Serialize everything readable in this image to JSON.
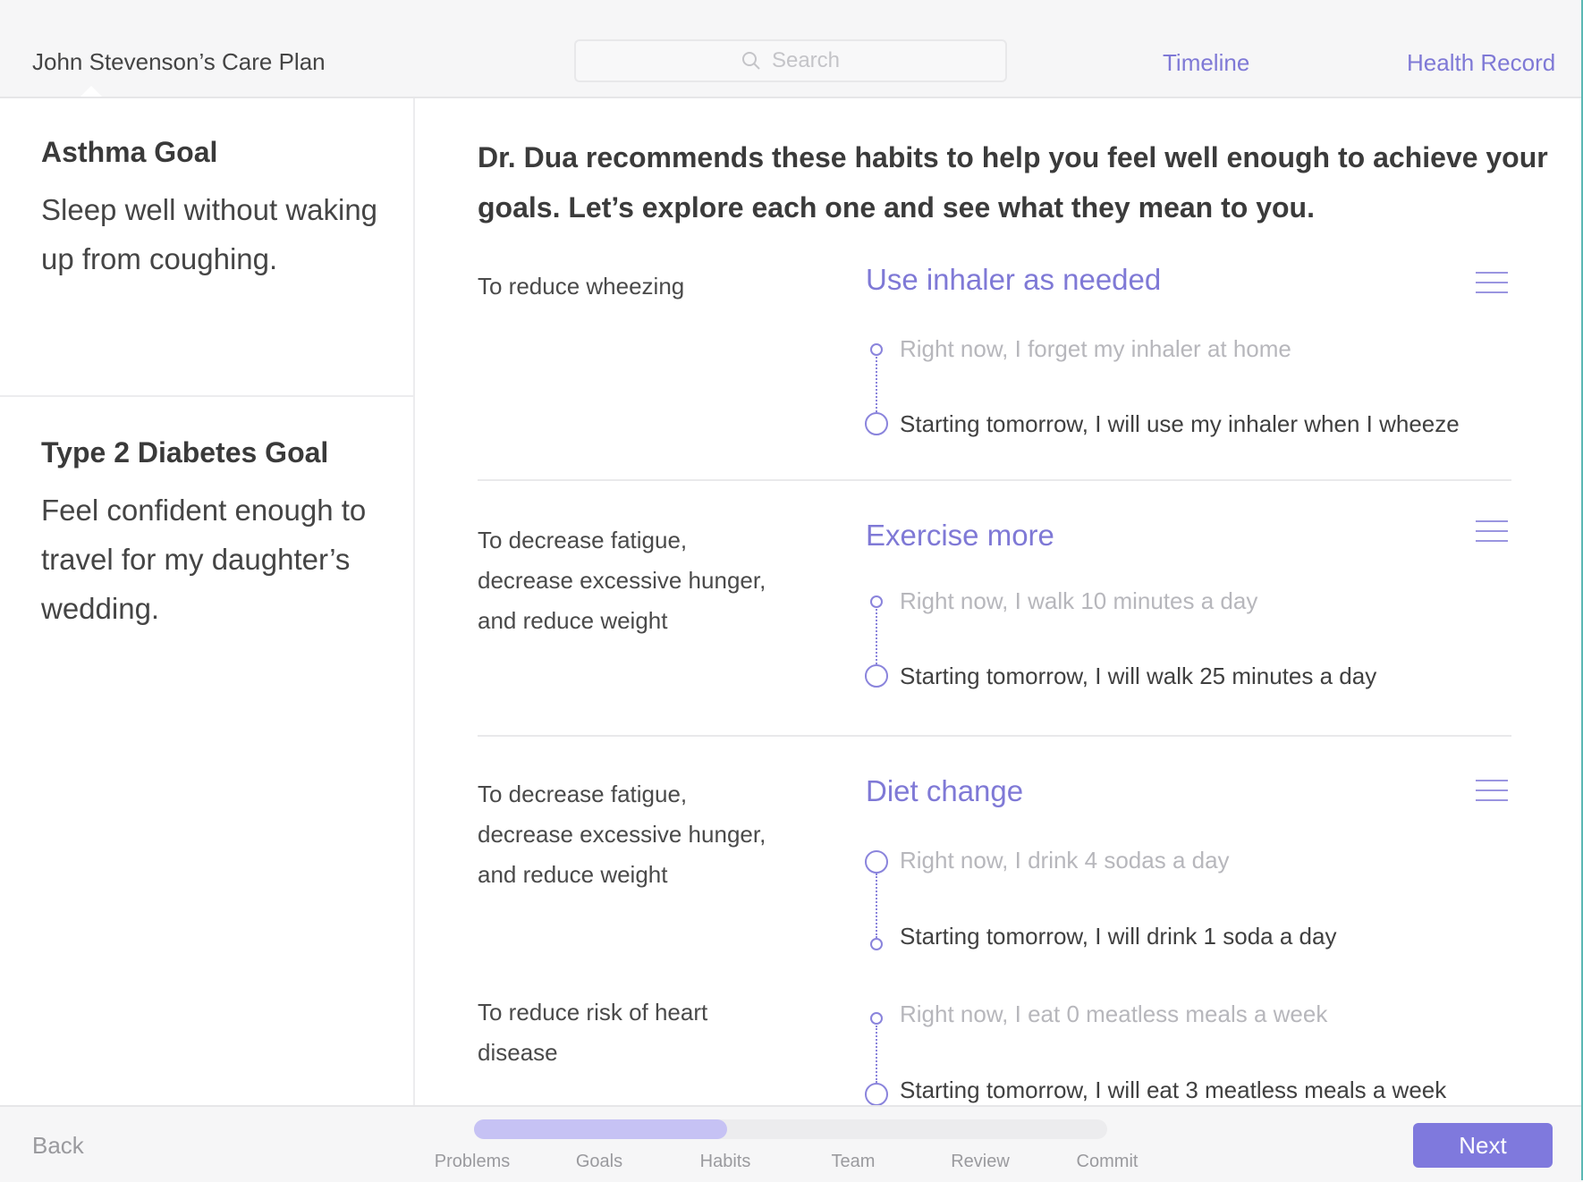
{
  "header": {
    "plan_title": "John Stevenson’s Care Plan",
    "search_placeholder": "Search",
    "nav": [
      "Timeline",
      "Health Record"
    ]
  },
  "sidebar": {
    "goals": [
      {
        "title": "Asthma Goal",
        "description": "Sleep well without waking up from coughing."
      },
      {
        "title": "Type 2 Diabetes Goal",
        "description": "Feel confident enough to travel for my daughter’s wedding."
      }
    ]
  },
  "main": {
    "intro": "Dr. Dua recommends these habits to help you feel well enough to achieve your goals. Let’s explore each one and see what they mean to you.",
    "habits": [
      {
        "title": "Use inhaler as needed",
        "reason": "To reduce wheezing",
        "now": "Right now, I forget my inhaler at home",
        "future": "Starting tomorrow, I will use my inhaler when I wheeze"
      },
      {
        "title": "Exercise more",
        "reason": "To decrease fatigue, decrease  excessive hunger, and reduce weight",
        "now": "Right now, I walk 10 minutes a day",
        "future": "Starting tomorrow, I will walk 25 minutes a day"
      },
      {
        "title": "Diet change",
        "reason": "To decrease fatigue, decrease  excessive hunger, and reduce weight",
        "now": "Right now, I drink 4 sodas a day",
        "future": "Starting tomorrow, I will drink 1 soda a day",
        "reason2": "To reduce risk of heart disease",
        "now2": "Right now, I eat 0 meatless meals a week",
        "future2": "Starting tomorrow, I will eat 3 meatless meals a week"
      }
    ]
  },
  "footer": {
    "back_label": "Back",
    "next_label": "Next",
    "steps": [
      "Problems",
      "Goals",
      "Habits",
      "Team",
      "Review",
      "Commit"
    ],
    "progress_fraction": 0.4
  },
  "colors": {
    "accent": "#7f79dd",
    "progress_fill": "#c6c2f4"
  }
}
